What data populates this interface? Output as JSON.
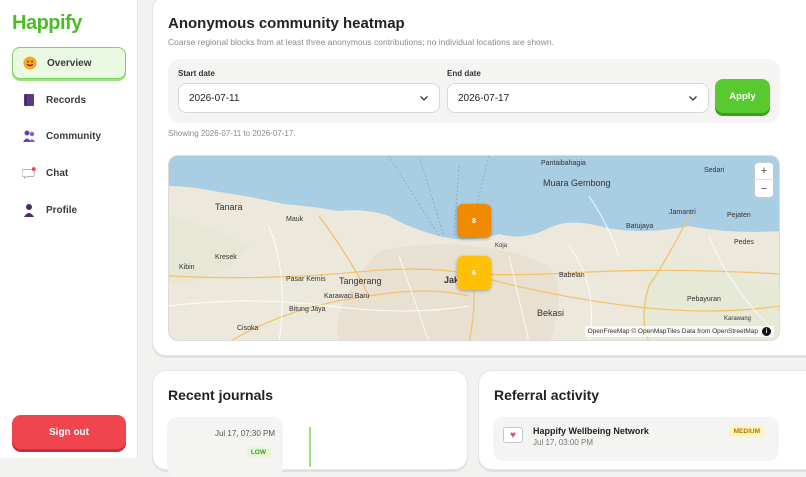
{
  "app": {
    "brand": "Happify"
  },
  "sidebar": {
    "items": [
      {
        "label": "Overview",
        "icon": "smiley-icon",
        "active": true
      },
      {
        "label": "Records",
        "icon": "journal-book-icon",
        "active": false
      },
      {
        "label": "Community",
        "icon": "community-people-icon",
        "active": false
      },
      {
        "label": "Chat",
        "icon": "chat-bubble-icon",
        "active": false
      },
      {
        "label": "Profile",
        "icon": "person-icon",
        "active": false
      }
    ],
    "sign_out": "Sign out"
  },
  "heatmap": {
    "title": "Anonymous community heatmap",
    "subtitle": "Coarse regional blocks from at least three anonymous contributions; no individual locations are shown.",
    "start_label": "Start date",
    "start_value": "2026-07-11",
    "end_label": "End date",
    "end_value": "2026-07-17",
    "apply_label": "Apply",
    "showing": "Showing 2026-07-11 to 2026-07-17.",
    "zoom_in": "+",
    "zoom_out": "−",
    "attribution": "OpenFreeMap © OpenMapTiles Data from OpenStreetMap",
    "blocks": [
      {
        "label": "8",
        "color": "#f08a00"
      },
      {
        "label": "6",
        "color": "#ffc107"
      }
    ],
    "places": [
      "Pantaibahagia",
      "Sedari",
      "Muara Gembong",
      "Tanara",
      "Mauk",
      "Jamantri",
      "Pejaten",
      "Batujaya",
      "Pedes",
      "Kresek",
      "Kibin",
      "Pasar Kemis",
      "Tangerang",
      "Jak",
      "Babelan",
      "Karawaci Baru",
      "Bitung Jaya",
      "Pebayuran",
      "Bekasi",
      "Cisoka",
      "Koja",
      "Karawang"
    ]
  },
  "journals": {
    "title": "Recent journals",
    "items": [
      {
        "date": "Jul 17, 07:30 PM",
        "level": "LOW"
      }
    ]
  },
  "referrals": {
    "title": "Referral activity",
    "items": [
      {
        "name": "Happify Wellbeing Network",
        "date": "Jul 17, 03:00 PM",
        "level": "MEDIUM"
      }
    ]
  },
  "colors": {
    "accent": "#58c92e",
    "danger": "#f0454f",
    "brand": "#4cbd28"
  }
}
